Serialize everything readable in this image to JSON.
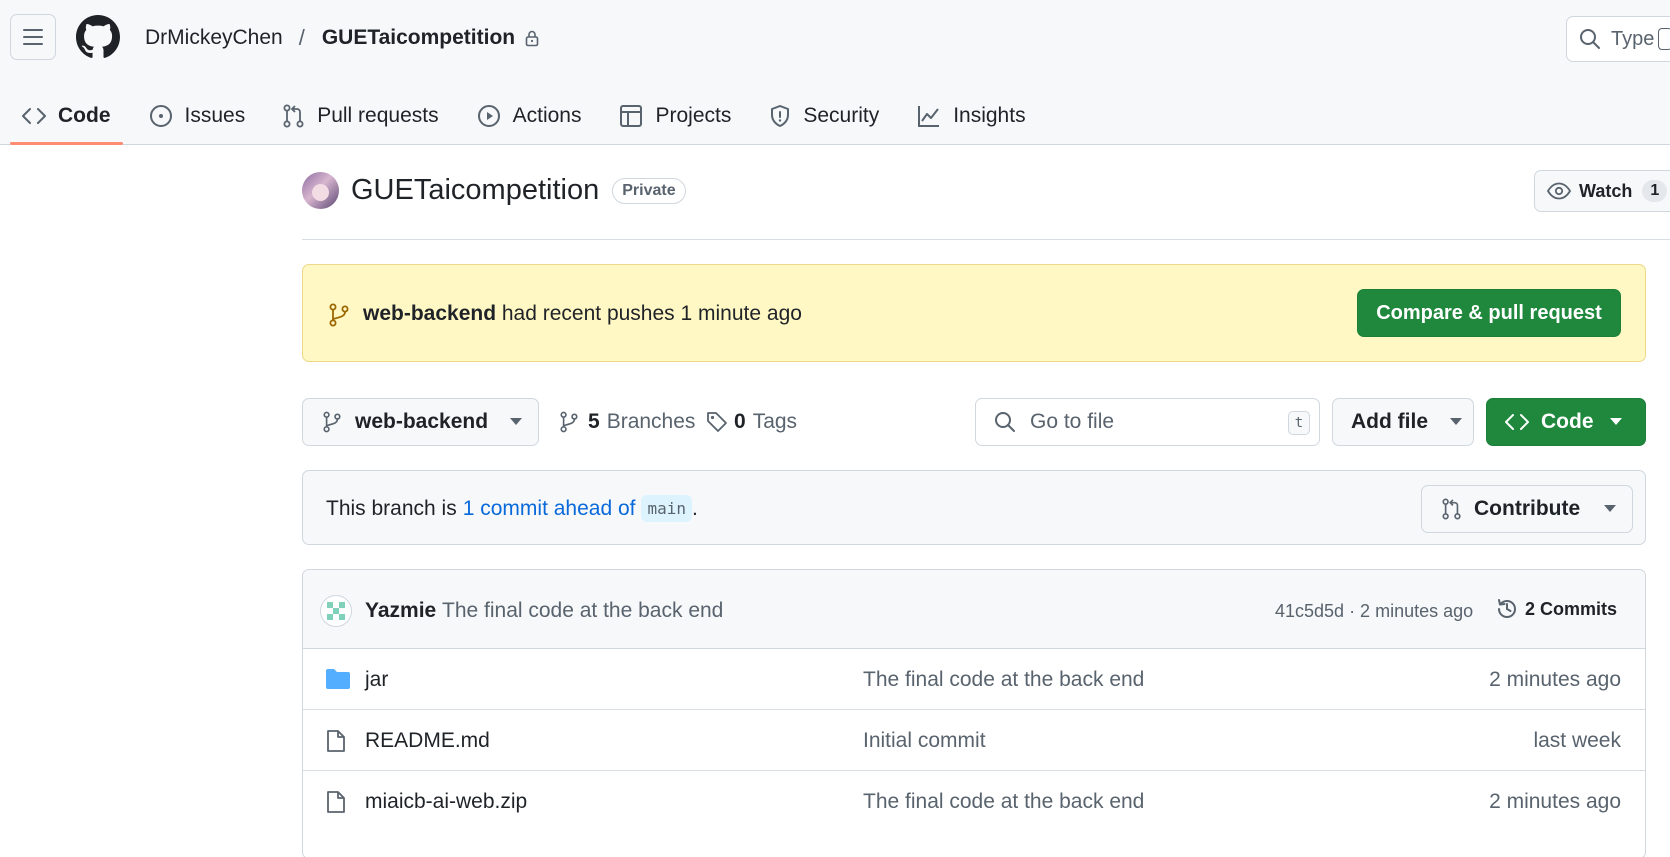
{
  "header": {
    "owner": "DrMickeyChen",
    "separator": "/",
    "repo": "GUETaicompetition",
    "search_placeholder": "Type"
  },
  "tabs": [
    {
      "label": "Code",
      "icon": "code-icon",
      "active": true
    },
    {
      "label": "Issues",
      "icon": "issue-icon"
    },
    {
      "label": "Pull requests",
      "icon": "pull-request-icon"
    },
    {
      "label": "Actions",
      "icon": "play-icon"
    },
    {
      "label": "Projects",
      "icon": "table-icon"
    },
    {
      "label": "Security",
      "icon": "shield-icon"
    },
    {
      "label": "Insights",
      "icon": "graph-icon"
    }
  ],
  "repo_header": {
    "title": "GUETaicompetition",
    "visibility": "Private",
    "watch_label": "Watch",
    "watch_count": "1"
  },
  "banner": {
    "branch": "web-backend",
    "message": " had recent pushes 1 minute ago",
    "button": "Compare & pull request"
  },
  "file_nav": {
    "current_branch": "web-backend",
    "branches_count": "5",
    "branches_label": "Branches",
    "tags_count": "0",
    "tags_label": "Tags",
    "go_to_file_placeholder": "Go to file",
    "go_to_file_shortcut": "t",
    "add_file_label": "Add file",
    "code_label": "Code"
  },
  "ahead": {
    "prefix": "This branch is",
    "link": "1 commit ahead of",
    "base_branch": "main",
    "suffix": ".",
    "contribute_label": "Contribute"
  },
  "latest_commit": {
    "author": "Yazmie",
    "message": "The final code at the back end",
    "hash_time": "41c5d5d · 2 minutes ago",
    "commits_label": "2 Commits"
  },
  "files": [
    {
      "name": "jar",
      "type": "folder",
      "commit": "The final code at the back end",
      "time": "2 minutes ago"
    },
    {
      "name": "README.md",
      "type": "file",
      "commit": "Initial commit",
      "time": "last week"
    },
    {
      "name": "miaicb-ai-web.zip",
      "type": "file",
      "commit": "The final code at the back end",
      "time": "2 minutes ago"
    }
  ],
  "colors": {
    "primary_green": "#1f883d",
    "banner_bg": "#fff8c5",
    "link_blue": "#0969da",
    "tab_underline": "#fd8c73",
    "folder_blue": "#54aeff"
  }
}
